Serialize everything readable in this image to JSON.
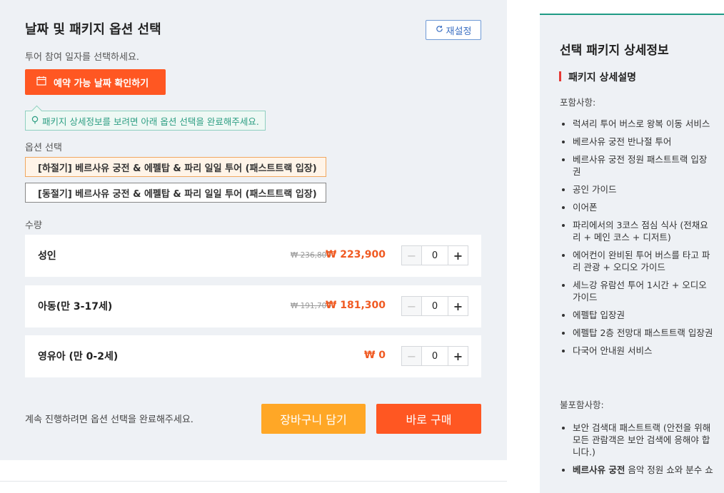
{
  "left": {
    "title": "날짜 및 패키지 옵션 선택",
    "reset_label": "재설정",
    "date_hint": "투어 참여 일자를 선택하세요.",
    "date_button_label": "예약 가능 날짜 확인하기",
    "tooltip": "패키지 상세정보를 보려면 아래 옵션 선택을 완료해주세요.",
    "option_label": "옵션 선택",
    "options": [
      "[하절기] 베르사유 궁전 & 에펠탑 & 파리 일일 투어 (패스트트랙 입장)",
      "[동절기] 베르사유 궁전 & 에펠탑 & 파리 일일 투어 (패스트트랙 입장)"
    ],
    "quantity_label": "수량",
    "rows": [
      {
        "name": "성인",
        "original_price": "₩ 236,800",
        "price": "₩ 223,900",
        "qty": "0"
      },
      {
        "name": "아동(만 3-17세)",
        "original_price": "₩ 191,700",
        "price": "₩ 181,300",
        "qty": "0"
      },
      {
        "name": "영유아 (만 0-2세)",
        "original_price": "",
        "price": "₩ 0",
        "qty": "0"
      }
    ],
    "footer_hint": "계속 진행하려면 옵션 선택을 완료해주세요.",
    "cart_label": "장바구니 담기",
    "buy_label": "바로 구매"
  },
  "right": {
    "title": "선택 패키지 상세정보",
    "subtitle": "패키지 상세설명",
    "included_label": "포함사항:",
    "included": [
      "럭셔리 투어 버스로 왕복 이동 서비스",
      "베르사유 궁전 반나절 투어",
      "베르사유 궁전 정원 패스트트랙 입장권",
      "공인 가이드",
      "이어폰",
      "파리에서의 3코스 점심 식사 (전채요리 + 메인 코스 + 디저트)",
      "에어컨이 완비된 투어 버스를 타고 파리 관광 + 오디오 가이드",
      "세느강 유람선 투어 1시간 + 오디오 가이드",
      "에펠탑 입장권",
      "에펠탑 2층 전망대 패스트트랙 입장권",
      "다국어 안내원 서비스"
    ],
    "excluded_label": "불포함사항:",
    "excluded": [
      {
        "bold": "",
        "text": "보안 검색대 패스트트랙 (안전을 위해 모든 관람객은 보안 검색에 응해야 합니다.)"
      },
      {
        "bold": "베르사유 궁전",
        "text": " 음악 정원 쇼와 분수 쇼"
      }
    ]
  },
  "colors": {
    "accent_orange": "#ff5722",
    "cart_orange": "#ffa726",
    "price_red": "#f05a22",
    "teal": "#1f9b85",
    "reset_blue": "#3b6fc2"
  },
  "icons": [
    "reset-icon",
    "calendar-icon",
    "info-bulb-icon",
    "minus-icon",
    "plus-icon"
  ]
}
